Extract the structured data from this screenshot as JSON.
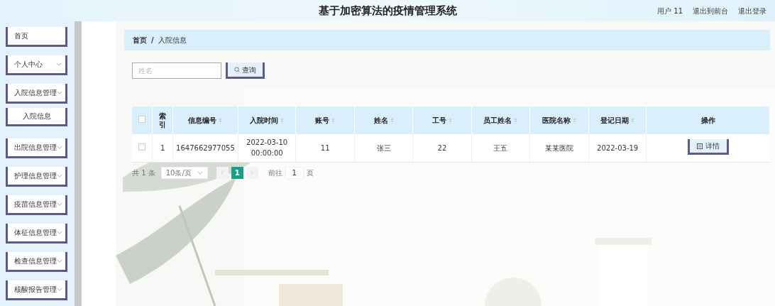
{
  "header": {
    "title": "基于加密算法的疫情管理系统",
    "user": "用户 11",
    "links": [
      "退出到前台",
      "退出登录"
    ]
  },
  "sidebar": {
    "items": [
      {
        "label": "首页",
        "kind": "link"
      },
      {
        "label": "个人中心",
        "kind": "group"
      },
      {
        "label": "入院信息管理",
        "kind": "group",
        "children": [
          {
            "label": "入院信息"
          }
        ]
      },
      {
        "label": "出院信息管理",
        "kind": "group"
      },
      {
        "label": "护理信息管理",
        "kind": "group"
      },
      {
        "label": "疫苗信息管理",
        "kind": "group"
      },
      {
        "label": "体征信息管理",
        "kind": "group"
      },
      {
        "label": "检查信息管理",
        "kind": "group"
      },
      {
        "label": "核酸报告管理",
        "kind": "group"
      }
    ]
  },
  "breadcrumb": [
    "首页",
    "/",
    "入院信息"
  ],
  "search": {
    "placeholder": "姓名",
    "button": "查询"
  },
  "table": {
    "all_checked": false,
    "columns": [
      {
        "label": "索引",
        "sortable": false
      },
      {
        "label": "信息编号",
        "sortable": true
      },
      {
        "label": "入院时间",
        "sortable": true
      },
      {
        "label": "账号",
        "sortable": true
      },
      {
        "label": "姓名",
        "sortable": true
      },
      {
        "label": "工号",
        "sortable": true
      },
      {
        "label": "员工姓名",
        "sortable": true
      },
      {
        "label": "医院名称",
        "sortable": true
      },
      {
        "label": "登记日期",
        "sortable": true
      },
      {
        "label": "操作",
        "sortable": false
      }
    ],
    "rows": [
      {
        "checked": false,
        "cells": [
          "1",
          "1647662977055",
          "2022-03-10 00:00:00",
          "11",
          "张三",
          "22",
          "王五",
          "某某医院",
          "2022-03-19"
        ],
        "action": "详情"
      }
    ]
  },
  "pagination": {
    "total": "共 1 条",
    "page_size": "10条/页",
    "pages": [
      {
        "label": "1",
        "selected": true
      }
    ],
    "goto_label": "前往",
    "goto_value": "1",
    "page_unit": "页"
  }
}
